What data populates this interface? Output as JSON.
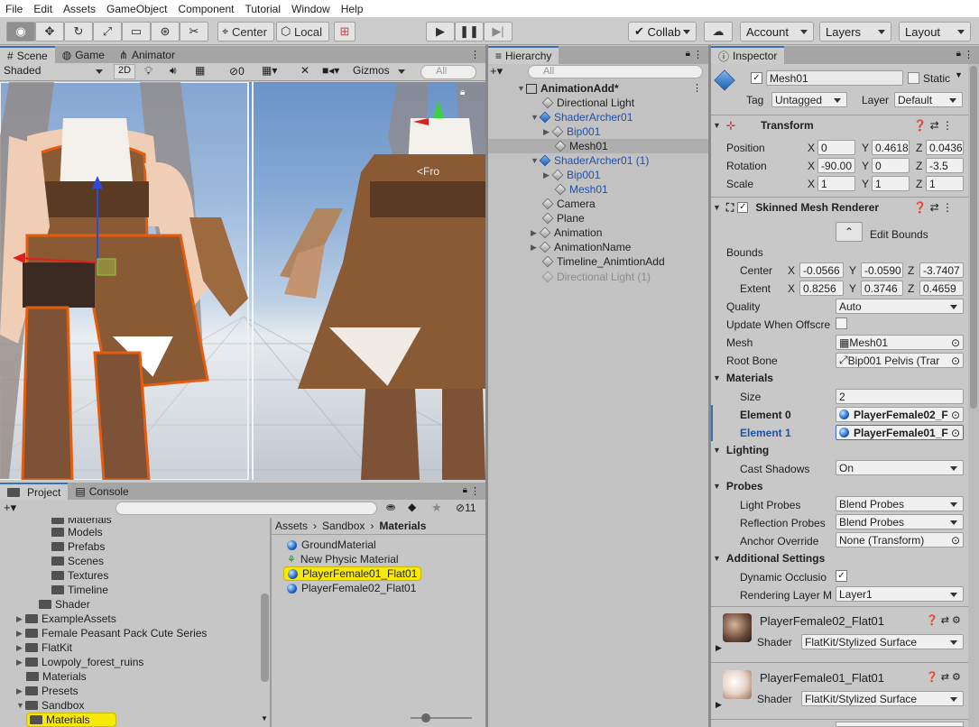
{
  "menu": [
    "File",
    "Edit",
    "Assets",
    "GameObject",
    "Component",
    "Tutorial",
    "Window",
    "Help"
  ],
  "toolbar": {
    "center": "Center",
    "local": "Local",
    "collab": "Collab",
    "account": "Account",
    "layers": "Layers",
    "layout": "Layout"
  },
  "scene": {
    "tabs": {
      "scene": "Scene",
      "game": "Game",
      "animator": "Animator"
    },
    "shading": "Shaded",
    "mode2d": "2D",
    "hidden_count": "0",
    "gizmos": "Gizmos",
    "search_placeholder": "All",
    "persp_label": "<Fro"
  },
  "hierarchy": {
    "tab": "Hierarchy",
    "search_placeholder": "All",
    "root": "AnimationAdd*",
    "items": [
      {
        "label": "Directional Light"
      },
      {
        "label": "ShaderArcher01"
      },
      {
        "label": "Bip001"
      },
      {
        "label": "Mesh01"
      },
      {
        "label": "ShaderArcher01 (1)"
      },
      {
        "label": "Bip001"
      },
      {
        "label": "Mesh01"
      },
      {
        "label": "Camera"
      },
      {
        "label": "Plane"
      },
      {
        "label": "Animation"
      },
      {
        "label": "AnimationName"
      },
      {
        "label": "Timeline_AnimtionAdd"
      },
      {
        "label": "Directional Light (1)"
      }
    ]
  },
  "project": {
    "tabs": {
      "project": "Project",
      "console": "Console"
    },
    "count": "11",
    "tree": [
      "Materials",
      "Models",
      "Prefabs",
      "Scenes",
      "Textures",
      "Timeline",
      "Shader",
      "ExampleAssets",
      "Female Peasant Pack Cute Series",
      "FlatKit",
      "Lowpoly_forest_ruins",
      "Materials",
      "Presets",
      "Sandbox",
      "Materials"
    ],
    "breadcrumb": [
      "Assets",
      "Sandbox",
      "Materials"
    ],
    "files": [
      "GroundMaterial",
      "New Physic Material",
      "PlayerFemale01_Flat01",
      "PlayerFemale02_Flat01"
    ]
  },
  "inspector": {
    "tab": "Inspector",
    "name": "Mesh01",
    "static": "Static",
    "tag_label": "Tag",
    "tag": "Untagged",
    "layer_label": "Layer",
    "layer": "Default",
    "transform": {
      "title": "Transform",
      "position_label": "Position",
      "rotation_label": "Rotation",
      "scale_label": "Scale",
      "px": "0",
      "py": "0.4618",
      "pz": "0.0436",
      "rx": "-90.00",
      "ry": "0",
      "rz": "-3.5",
      "sx": "1",
      "sy": "1",
      "sz": "1"
    },
    "smr": {
      "title": "Skinned Mesh Renderer",
      "edit_bounds": "Edit Bounds",
      "bounds": "Bounds",
      "center": "Center",
      "extent": "Extent",
      "cx": "-0.0566",
      "cy": "-0.0590",
      "cz": "-3.7407",
      "ex": "0.8256",
      "ey": "0.3746",
      "ez": "0.4659",
      "quality_label": "Quality",
      "quality": "Auto",
      "update_label": "Update When Offscre",
      "mesh_label": "Mesh",
      "mesh": "Mesh01",
      "rootbone_label": "Root Bone",
      "rootbone": "Bip001 Pelvis (Trar",
      "materials": "Materials",
      "size_label": "Size",
      "size": "2",
      "el0_label": "Element 0",
      "el0": "PlayerFemale02_F",
      "el1_label": "Element 1",
      "el1": "PlayerFemale01_F",
      "lighting": "Lighting",
      "cast_label": "Cast Shadows",
      "cast": "On",
      "probes": "Probes",
      "light_probes_label": "Light Probes",
      "light_probes": "Blend Probes",
      "refl_label": "Reflection Probes",
      "refl": "Blend Probes",
      "anchor_label": "Anchor Override",
      "anchor": "None (Transform)",
      "additional": "Additional Settings",
      "dyn_label": "Dynamic Occlusio",
      "rlayer_label": "Rendering Layer M",
      "rlayer": "Layer1"
    },
    "mat1": {
      "name": "PlayerFemale02_Flat01",
      "shader_label": "Shader",
      "shader": "FlatKit/Stylized Surface"
    },
    "mat2": {
      "name": "PlayerFemale01_Flat01",
      "shader_label": "Shader",
      "shader": "FlatKit/Stylized Surface"
    }
  },
  "colors": {
    "selection_yellow": "#f6e90a",
    "link_blue": "#1f50a8",
    "accent": "#3a72b0"
  }
}
